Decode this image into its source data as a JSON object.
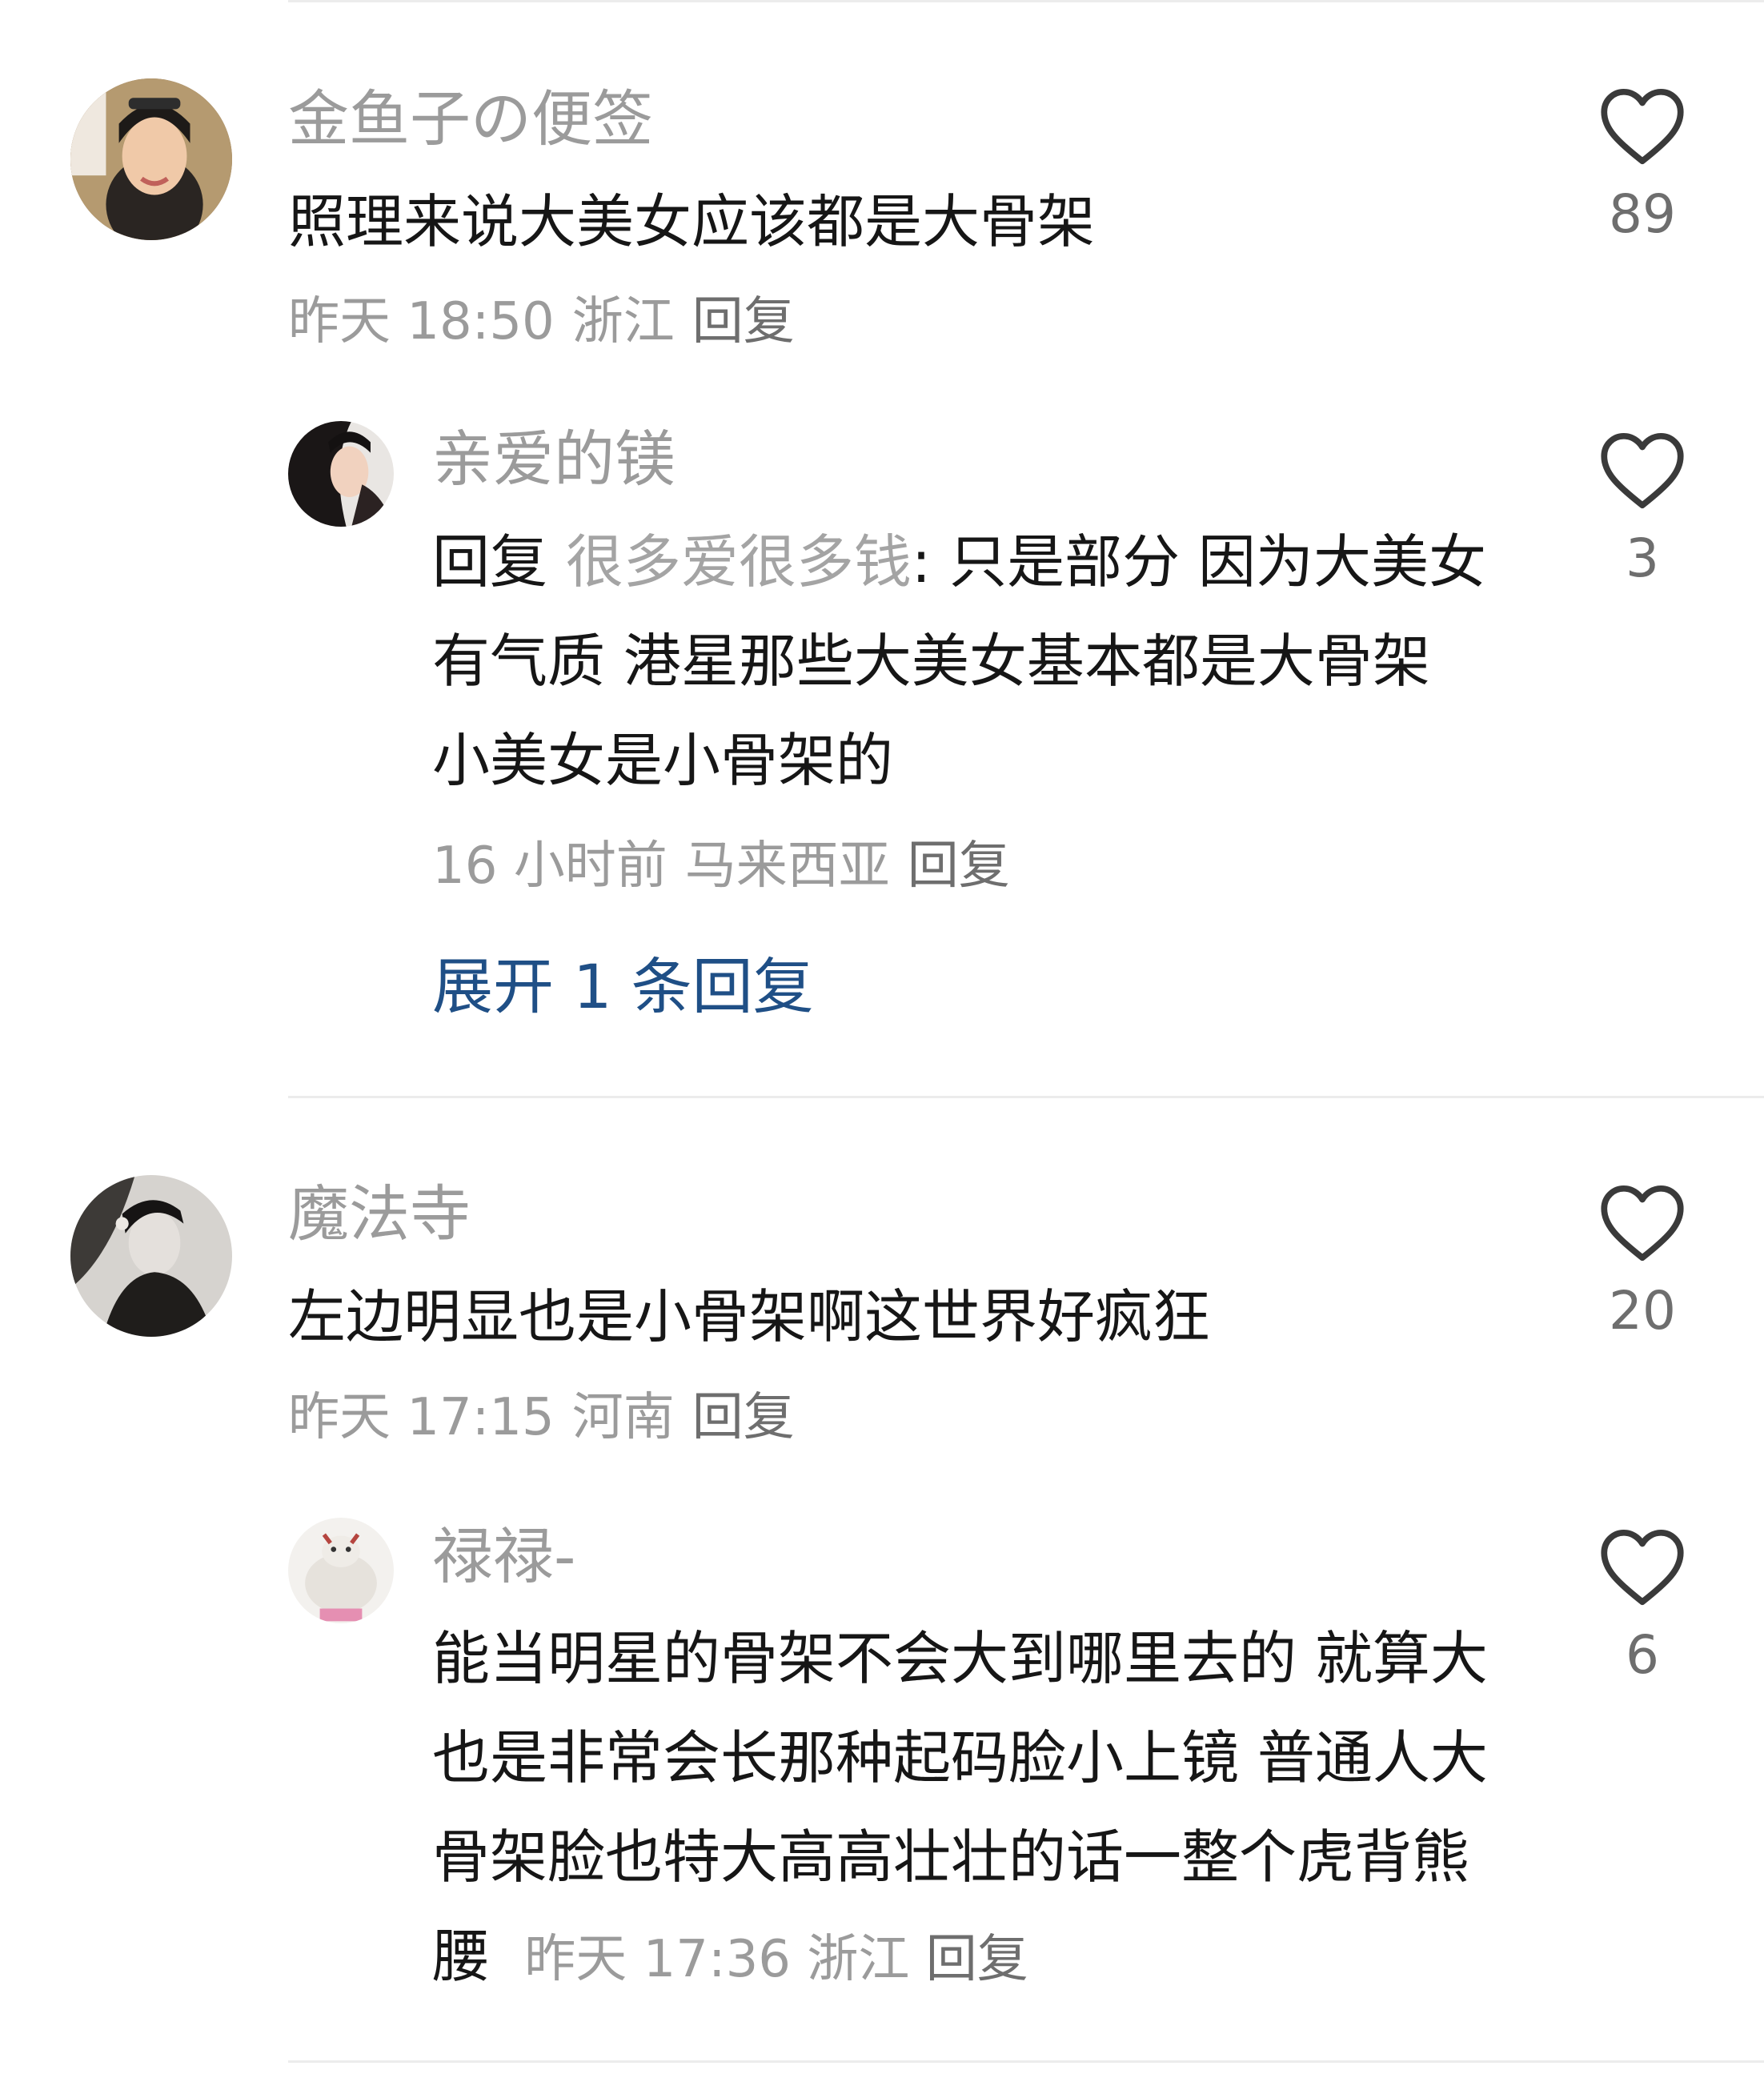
{
  "comments": [
    {
      "username": "金鱼子の便签",
      "text": "照理来说大美女应该都是大骨架",
      "time": "昨天 18:50",
      "location": "浙江",
      "reply_label": "回复",
      "likes": "89",
      "replies": [
        {
          "username": "亲爱的镁",
          "reply_prefix": "回复",
          "mention": "很多爱很多钱",
          "text": ": 只是部分 因为大美女有气质 港星那些大美女基本都是大骨架 小美女是小骨架的",
          "time": "16 小时前",
          "location": "马来西亚",
          "reply_label": "回复",
          "likes": "3"
        }
      ],
      "expand_label": "展开 1 条回复"
    },
    {
      "username": "魔法寺",
      "text": "左边明显也是小骨架啊这世界好疯狂",
      "time": "昨天 17:15",
      "location": "河南",
      "reply_label": "回复",
      "likes": "20",
      "replies": [
        {
          "username": "禄禄-",
          "text": "能当明星的骨架不会大到哪里去的 就算大 也是非常会长那种起码脸小上镜 普通人大骨架脸也特大高高壮壮的话一整个虎背熊腰",
          "time": "昨天 17:36",
          "location": "浙江",
          "reply_label": "回复",
          "likes": "6"
        }
      ]
    }
  ],
  "icons": {
    "like": "heart-outline-icon"
  },
  "colors": {
    "username": "#9b9b9b",
    "text": "#161616",
    "link": "#1f4f86"
  }
}
